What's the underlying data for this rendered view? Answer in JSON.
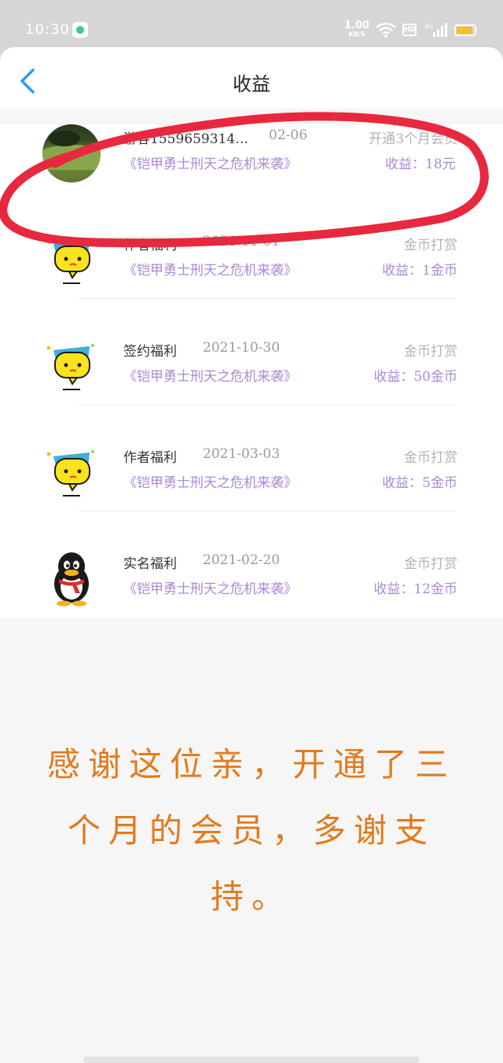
{
  "status_bar": {
    "time": "10:30",
    "speed_value": "1.00",
    "speed_unit": "KB/S",
    "hd": "HD",
    "network": "4G",
    "battery_level": 0.9
  },
  "header": {
    "title": "收益"
  },
  "records": [
    {
      "name": "游客1559659314…",
      "date": "02-06",
      "type": "开通3个月会员",
      "book": "《铠甲勇士刑天之危机来袭》",
      "income": "收益：18元",
      "avatar": "photo"
    },
    {
      "name": "作者福利",
      "date": "2021-11-01",
      "type": "金币打赏",
      "book": "《铠甲勇士刑天之危机来袭》",
      "income": "收益：1金币",
      "avatar": "chat-bubble"
    },
    {
      "name": "签约福利",
      "date": "2021-10-30",
      "type": "金币打赏",
      "book": "《铠甲勇士刑天之危机来袭》",
      "income": "收益：50金币",
      "avatar": "chat-bubble"
    },
    {
      "name": "作者福利",
      "date": "2021-03-03",
      "type": "金币打赏",
      "book": "《铠甲勇士刑天之危机来袭》",
      "income": "收益：5金币",
      "avatar": "chat-bubble"
    },
    {
      "name": "实名福利",
      "date": "2021-02-20",
      "type": "金币打赏",
      "book": "《铠甲勇士刑天之危机来袭》",
      "income": "收益：12金币",
      "avatar": "penguin"
    }
  ],
  "note": {
    "line1": "感谢这位亲，开通了三",
    "line2": "个月的会员，多谢支",
    "line3": "持。"
  },
  "colors": {
    "accent": "#2a9df4",
    "book_link": "#a98ad6",
    "highlight": "#e8283e",
    "note": "#e27a1d"
  }
}
